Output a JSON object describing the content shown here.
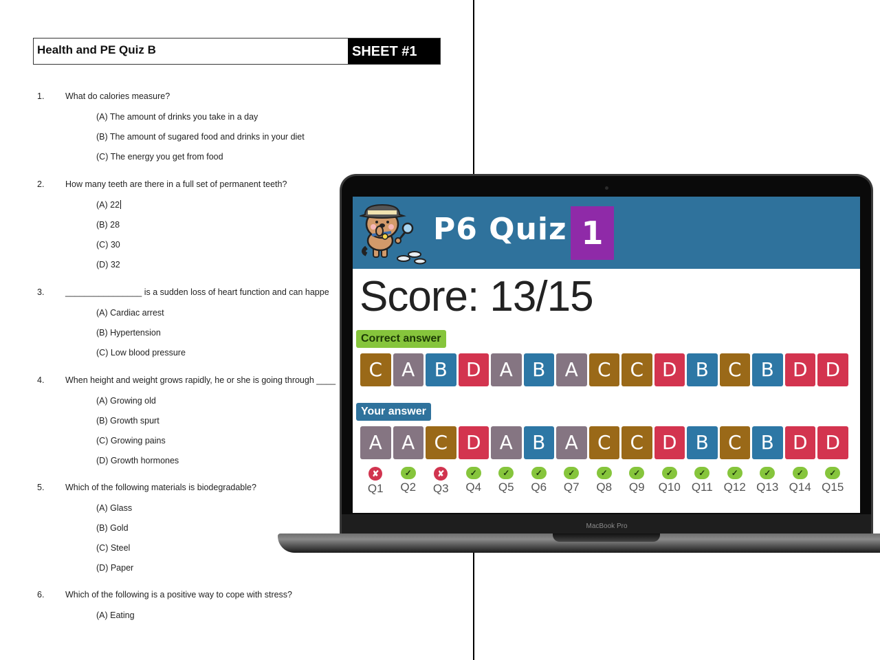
{
  "worksheet": {
    "title": "Health and PE Quiz B",
    "sheet_label": "SHEET #1",
    "questions": [
      {
        "number": "1.",
        "text": "What do calories measure?",
        "options": [
          "(A) The amount of drinks you take in a day",
          "(B) The amount of sugared food and drinks in your diet",
          "(C) The energy you get from food"
        ]
      },
      {
        "number": "2.",
        "text": "How many teeth are there in a full set of permanent teeth?",
        "options": [
          "(A) 22",
          "(B) 28",
          "(C) 30",
          "(D) 32"
        ]
      },
      {
        "number": "3.",
        "text": "________________ is a sudden loss of heart function and can happe",
        "options": [
          "(A) Cardiac arrest",
          "(B) Hypertension",
          "(C) Low blood pressure"
        ]
      },
      {
        "number": "4.",
        "text": "When height and weight grows rapidly, he or she is going through ____",
        "options": [
          "(A) Growing old",
          "(B) Growth spurt",
          "(C) Growing pains",
          "(D) Growth hormones"
        ]
      },
      {
        "number": "5.",
        "text": "Which of the following materials is biodegradable?",
        "options": [
          "(A) Glass",
          "(B) Gold",
          "(C) Steel",
          "(D) Paper"
        ]
      },
      {
        "number": "6.",
        "text": "Which of the following is a positive way to cope with stress?",
        "options": [
          "(A) Eating"
        ]
      }
    ]
  },
  "laptop": {
    "brand_label": "MacBook Pro",
    "app": {
      "mascot_icon": "detective-dog-icon",
      "title": "P6 Quiz",
      "quiz_number": "1",
      "score_text": "Score: 13/15",
      "correct_label": "Correct answer",
      "your_label": "Your answer",
      "answer_colors": {
        "A": "#857582",
        "B": "#2d77a5",
        "C": "#9a6918",
        "D": "#d3344f"
      },
      "correct_answers": [
        "C",
        "A",
        "B",
        "D",
        "A",
        "B",
        "A",
        "C",
        "C",
        "D",
        "B",
        "C",
        "B",
        "D",
        "D"
      ],
      "your_answers": [
        "A",
        "A",
        "C",
        "D",
        "A",
        "B",
        "A",
        "C",
        "C",
        "D",
        "B",
        "C",
        "B",
        "D",
        "D"
      ],
      "results": [
        {
          "label": "Q1",
          "correct": false,
          "icon": "✘"
        },
        {
          "label": "Q2",
          "correct": true,
          "icon": "✓"
        },
        {
          "label": "Q3",
          "correct": false,
          "icon": "✘"
        },
        {
          "label": "Q4",
          "correct": true,
          "icon": "✓"
        },
        {
          "label": "Q5",
          "correct": true,
          "icon": "✓"
        },
        {
          "label": "Q6",
          "correct": true,
          "icon": "✓"
        },
        {
          "label": "Q7",
          "correct": true,
          "icon": "✓"
        },
        {
          "label": "Q8",
          "correct": true,
          "icon": "✓"
        },
        {
          "label": "Q9",
          "correct": true,
          "icon": "✓"
        },
        {
          "label": "Q10",
          "correct": true,
          "icon": "✓"
        },
        {
          "label": "Q11",
          "correct": true,
          "icon": "✓"
        },
        {
          "label": "Q12",
          "correct": true,
          "icon": "✓"
        },
        {
          "label": "Q13",
          "correct": true,
          "icon": "✓"
        },
        {
          "label": "Q14",
          "correct": true,
          "icon": "✓"
        },
        {
          "label": "Q15",
          "correct": true,
          "icon": "✓"
        }
      ]
    }
  }
}
